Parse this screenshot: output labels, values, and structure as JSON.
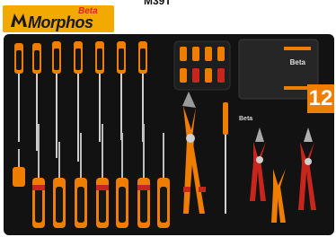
{
  "brand": {
    "name": "Morphos",
    "maker": "Beta",
    "logo_bg": "#f2a900",
    "logo_text_color": "#1a1a1a",
    "maker_color": "#d9261c"
  },
  "header": {
    "code": "M39T"
  },
  "tray": {
    "bg": "#121212",
    "accent": "#ef7d00",
    "red": "#c8261c",
    "case_label": "Beta",
    "pliers_label": "Beta",
    "badge": "12"
  }
}
